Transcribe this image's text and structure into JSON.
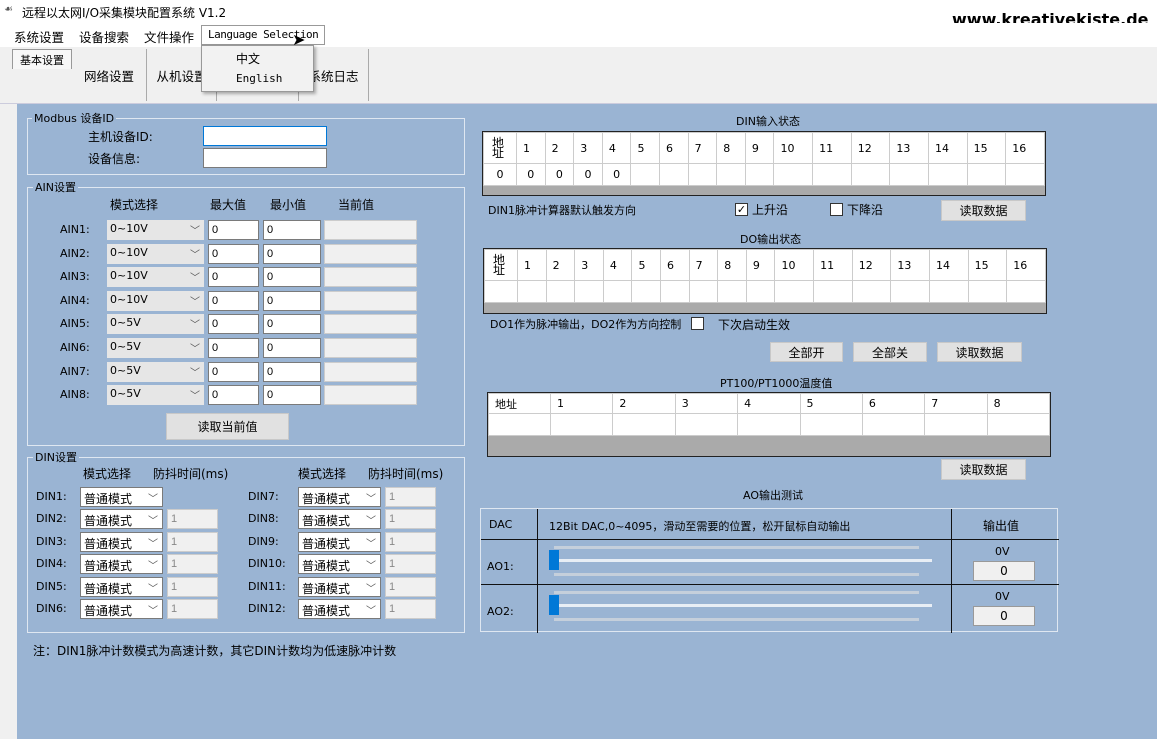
{
  "window": {
    "title": "远程以太网I/O采集模块配置系统 V1.2",
    "watermark": "www.kreativekiste.de"
  },
  "menu": {
    "items": [
      "系统设置",
      "设备搜索",
      "文件操作",
      "Language Selection"
    ],
    "dropdown": [
      "中文",
      "English"
    ]
  },
  "tabs": [
    "基本设置",
    "网络设置",
    "从机设置",
    "",
    "系统日志"
  ],
  "modbus": {
    "legend": "Modbus 设备ID",
    "host_label": "主机设备ID:",
    "host_value": "",
    "info_label": "设备信息:",
    "info_value": ""
  },
  "ain": {
    "legend": "AIN设置",
    "headers": [
      "模式选择",
      "最大值",
      "最小值",
      "当前值"
    ],
    "rows": [
      {
        "label": "AIN1:",
        "mode": "0~10V",
        "max": "0",
        "min": "0",
        "current": ""
      },
      {
        "label": "AIN2:",
        "mode": "0~10V",
        "max": "0",
        "min": "0",
        "current": ""
      },
      {
        "label": "AIN3:",
        "mode": "0~10V",
        "max": "0",
        "min": "0",
        "current": ""
      },
      {
        "label": "AIN4:",
        "mode": "0~10V",
        "max": "0",
        "min": "0",
        "current": ""
      },
      {
        "label": "AIN5:",
        "mode": "0~5V",
        "max": "0",
        "min": "0",
        "current": ""
      },
      {
        "label": "AIN6:",
        "mode": "0~5V",
        "max": "0",
        "min": "0",
        "current": ""
      },
      {
        "label": "AIN7:",
        "mode": "0~5V",
        "max": "0",
        "min": "0",
        "current": ""
      },
      {
        "label": "AIN8:",
        "mode": "0~5V",
        "max": "0",
        "min": "0",
        "current": ""
      }
    ],
    "read_button": "读取当前值"
  },
  "din": {
    "legend": "DIN设置",
    "headers": [
      "模式选择",
      "防抖时间(ms)"
    ],
    "rows": [
      {
        "label": "DIN1:",
        "mode": "普通模式",
        "debounce": null
      },
      {
        "label": "DIN2:",
        "mode": "普通模式",
        "debounce": "1"
      },
      {
        "label": "DIN3:",
        "mode": "普通模式",
        "debounce": "1"
      },
      {
        "label": "DIN4:",
        "mode": "普通模式",
        "debounce": "1"
      },
      {
        "label": "DIN5:",
        "mode": "普通模式",
        "debounce": "1"
      },
      {
        "label": "DIN6:",
        "mode": "普通模式",
        "debounce": "1"
      },
      {
        "label": "DIN7:",
        "mode": "普通模式",
        "debounce": "1"
      },
      {
        "label": "DIN8:",
        "mode": "普通模式",
        "debounce": "1"
      },
      {
        "label": "DIN9:",
        "mode": "普通模式",
        "debounce": "1"
      },
      {
        "label": "DIN10:",
        "mode": "普通模式",
        "debounce": "1"
      },
      {
        "label": "DIN11:",
        "mode": "普通模式",
        "debounce": "1"
      },
      {
        "label": "DIN12:",
        "mode": "普通模式",
        "debounce": "1"
      }
    ],
    "note": "注：DIN1脉冲计数模式为高速计数，其它DIN计数均为低速脉冲计数"
  },
  "din_status": {
    "title": "DIN输入状态",
    "headers": [
      "地址",
      "1",
      "2",
      "3",
      "4",
      "5",
      "6",
      "7",
      "8",
      "9",
      "10",
      "11",
      "12",
      "13",
      "14",
      "15",
      "16"
    ],
    "values": [
      "0",
      "0",
      "0",
      "0",
      "0",
      "",
      "",
      "",
      "",
      "",
      "",
      "",
      "",
      "",
      "",
      "",
      ""
    ],
    "trigger_label": "DIN1脉冲计算器默认触发方向",
    "rising": "上升沿",
    "rising_checked": true,
    "falling": "下降沿",
    "falling_checked": false,
    "read_button": "读取数据"
  },
  "do_status": {
    "title": "DO输出状态",
    "headers": [
      "地址",
      "1",
      "2",
      "3",
      "4",
      "5",
      "6",
      "7",
      "8",
      "9",
      "10",
      "11",
      "12",
      "13",
      "14",
      "15",
      "16"
    ],
    "values": [
      "",
      "",
      "",
      "",
      "",
      "",
      "",
      "",
      "",
      "",
      "",
      "",
      "",
      "",
      "",
      "",
      ""
    ],
    "pulse_label": "DO1作为脉冲输出，DO2作为方向控制",
    "pulse_checked": false,
    "next_boot": "下次启动生效",
    "all_on": "全部开",
    "all_off": "全部关",
    "read_button": "读取数据"
  },
  "pt100": {
    "title": "PT100/PT1000温度值",
    "headers": [
      "地址",
      "1",
      "2",
      "3",
      "4",
      "5",
      "6",
      "7",
      "8"
    ],
    "values": [
      "",
      "",
      "",
      "",
      "",
      "",
      "",
      "",
      ""
    ],
    "read_button": "读取数据"
  },
  "ao": {
    "title": "AO输出测试",
    "col_dac": "DAC",
    "description": "12Bit DAC,0~4095，滑动至需要的位置，松开鼠标自动输出",
    "col_output": "输出值",
    "rows": [
      {
        "label": "AO1:",
        "voltage": "0V",
        "value": "0",
        "slider": 0
      },
      {
        "label": "AO2:",
        "voltage": "0V",
        "value": "0",
        "slider": 0
      }
    ],
    "accent": "#0078d7"
  }
}
